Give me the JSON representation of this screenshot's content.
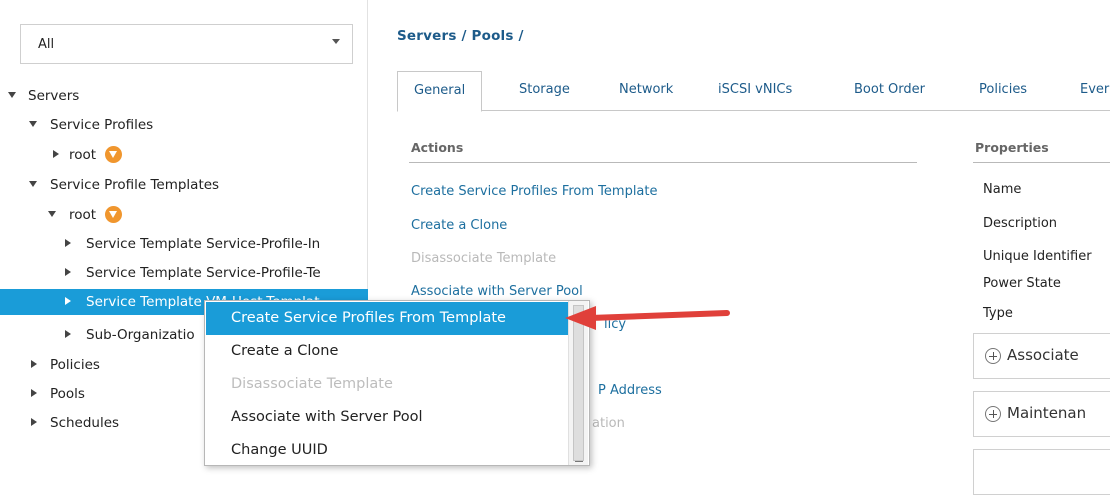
{
  "filter": {
    "value": "All"
  },
  "tree": [
    {
      "label": "Servers"
    },
    {
      "label": "Service Profiles"
    },
    {
      "label": "root"
    },
    {
      "label": "Service Profile Templates"
    },
    {
      "label": "root"
    },
    {
      "label": "Service Template Service-Profile-In"
    },
    {
      "label": "Service Template Service-Profile-Te"
    },
    {
      "label": "Service Template VM-Host-Templat"
    },
    {
      "label": "Sub-Organizatio"
    },
    {
      "label": "Policies"
    },
    {
      "label": "Pools"
    },
    {
      "label": "Schedules"
    }
  ],
  "breadcrumb": "Servers / Pools /",
  "tabs": [
    "General",
    "Storage",
    "Network",
    "iSCSI vNICs",
    "Boot Order",
    "Policies",
    "Ever"
  ],
  "actions": {
    "heading": "Actions",
    "items": [
      "Create Service Profiles From Template",
      "Create a Clone",
      "Disassociate Template",
      "Associate with Server Pool",
      "licy",
      "P Address",
      "ation"
    ]
  },
  "properties": {
    "heading": "Properties",
    "items": [
      "Name",
      "Description",
      "Unique Identifier",
      "Power State",
      "Type"
    ]
  },
  "panels": [
    "Associate",
    "Maintenan"
  ],
  "context_menu": {
    "items": [
      "Create Service Profiles From Template",
      "Create a Clone",
      "Disassociate Template",
      "Associate with Server Pool",
      "Change UUID"
    ]
  },
  "colors": {
    "accent": "#1a9cd8",
    "link": "#1d6f9f",
    "arrow": "#e0403a",
    "org_badge": "#f0962e"
  }
}
